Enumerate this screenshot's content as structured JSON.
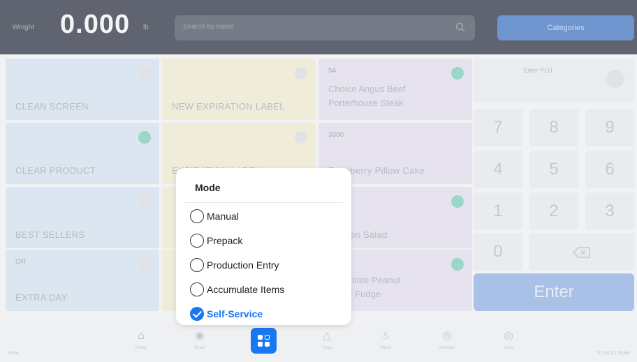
{
  "topbar": {
    "weight_label": "Weight",
    "weight_value": "0.000",
    "weight_unit": "lb",
    "search_placeholder": "Search by name",
    "categories_label": "Categories"
  },
  "tiles": {
    "clean_screen": "CLEAN SCREEN",
    "new_expiration_label": "NEW EXPIRATION LABEL",
    "porterhouse_code": "54",
    "porterhouse_line1": "Choice Angus Beef",
    "porterhouse_line2": "Porterhouse Steak",
    "clear_product": "CLEAR PRODUCT",
    "expiration_label": "EXPIRATION LABEL",
    "cake_code": "3360",
    "cake_name": "Raspberry Pillow Cake",
    "best_sellers": "BEST SELLERS",
    "salad_name": "Salmon Salad",
    "extra_day_code": "OR",
    "extra_day": "EXTRA DAY",
    "fudge_line1": "Chocolate Peanut",
    "fudge_line2": "Butter Fudge"
  },
  "keypad": {
    "enter_plu_label": "Enter PLU",
    "keys": [
      "7",
      "8",
      "9",
      "4",
      "5",
      "6",
      "1",
      "2",
      "3",
      "0"
    ],
    "backspace_icon": "backspace-icon",
    "enter_label": "Enter"
  },
  "mode_popup": {
    "title": "Mode",
    "options": [
      {
        "label": "Manual",
        "selected": false
      },
      {
        "label": "Prepack",
        "selected": false
      },
      {
        "label": "Production Entry",
        "selected": false
      },
      {
        "label": "Accumulate Items",
        "selected": false
      },
      {
        "label": "Self-Service",
        "selected": true
      }
    ]
  },
  "bottom_nav": {
    "items": [
      {
        "label": "Home",
        "icon": "home-icon"
      },
      {
        "label": "Scale",
        "icon": "scale-icon"
      },
      {
        "label": "Apps",
        "icon": "apps-icon"
      },
      {
        "label": "Trays",
        "icon": "trays-icon"
      },
      {
        "label": "Alerts",
        "icon": "bell-icon"
      },
      {
        "label": "Network",
        "icon": "globe-icon"
      },
      {
        "label": "Store",
        "icon": "store-icon"
      }
    ],
    "footer_left": "Store",
    "footer_right": "01 04:21 Scale"
  },
  "colors": {
    "accent": "#1877f2",
    "topbar": "#5f6470",
    "tile_blue": "#dbe6f0",
    "tile_yellow": "#f0ecda",
    "tile_purple": "#e6e3ee",
    "status_green": "#9ad8c5"
  }
}
